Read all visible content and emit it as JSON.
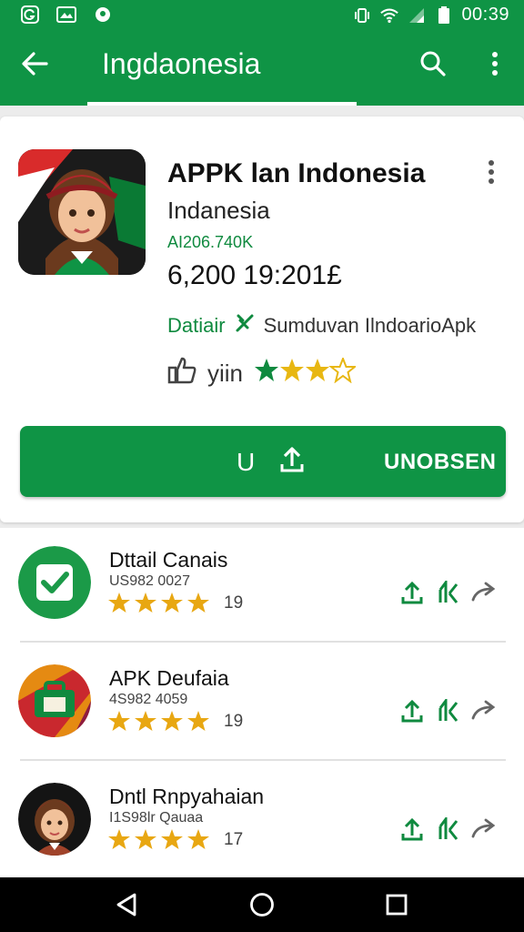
{
  "status_bar": {
    "time": "00:39",
    "icons": [
      "g-app-icon",
      "gallery-icon",
      "pin-icon",
      "vibrate-icon",
      "wifi-icon",
      "signal-icon",
      "battery-icon"
    ]
  },
  "app_bar": {
    "title": "Ingdaonesia",
    "color": "#0f9445"
  },
  "app_header": {
    "name": "APPK lan Indonesia",
    "developer": "Indanesia",
    "version": "AI206.740K",
    "downloads": "6,200 19:201£",
    "detail_label": "Datiair",
    "detail_text": "Sumduvan IlndoarioApk",
    "rating_text": "yiin",
    "install_prefix": "U",
    "install_label": "UNOBSEN"
  },
  "list": {
    "items": [
      {
        "title": "Dttail Canais",
        "subtitle": "US982 0027",
        "count": "19",
        "icon": "check-app-icon"
      },
      {
        "title": "APK Deufaia",
        "subtitle": "4S982 4059",
        "count": "19",
        "icon": "bag-app-icon"
      },
      {
        "title": "Dntl Rnpyahaian",
        "subtitle": "I1S98lr Qauaa",
        "count": "17",
        "icon": "avatar-app-icon"
      }
    ]
  },
  "nav_bar": {
    "icons": [
      "back-triangle-icon",
      "home-circle-icon",
      "recents-square-icon"
    ]
  }
}
